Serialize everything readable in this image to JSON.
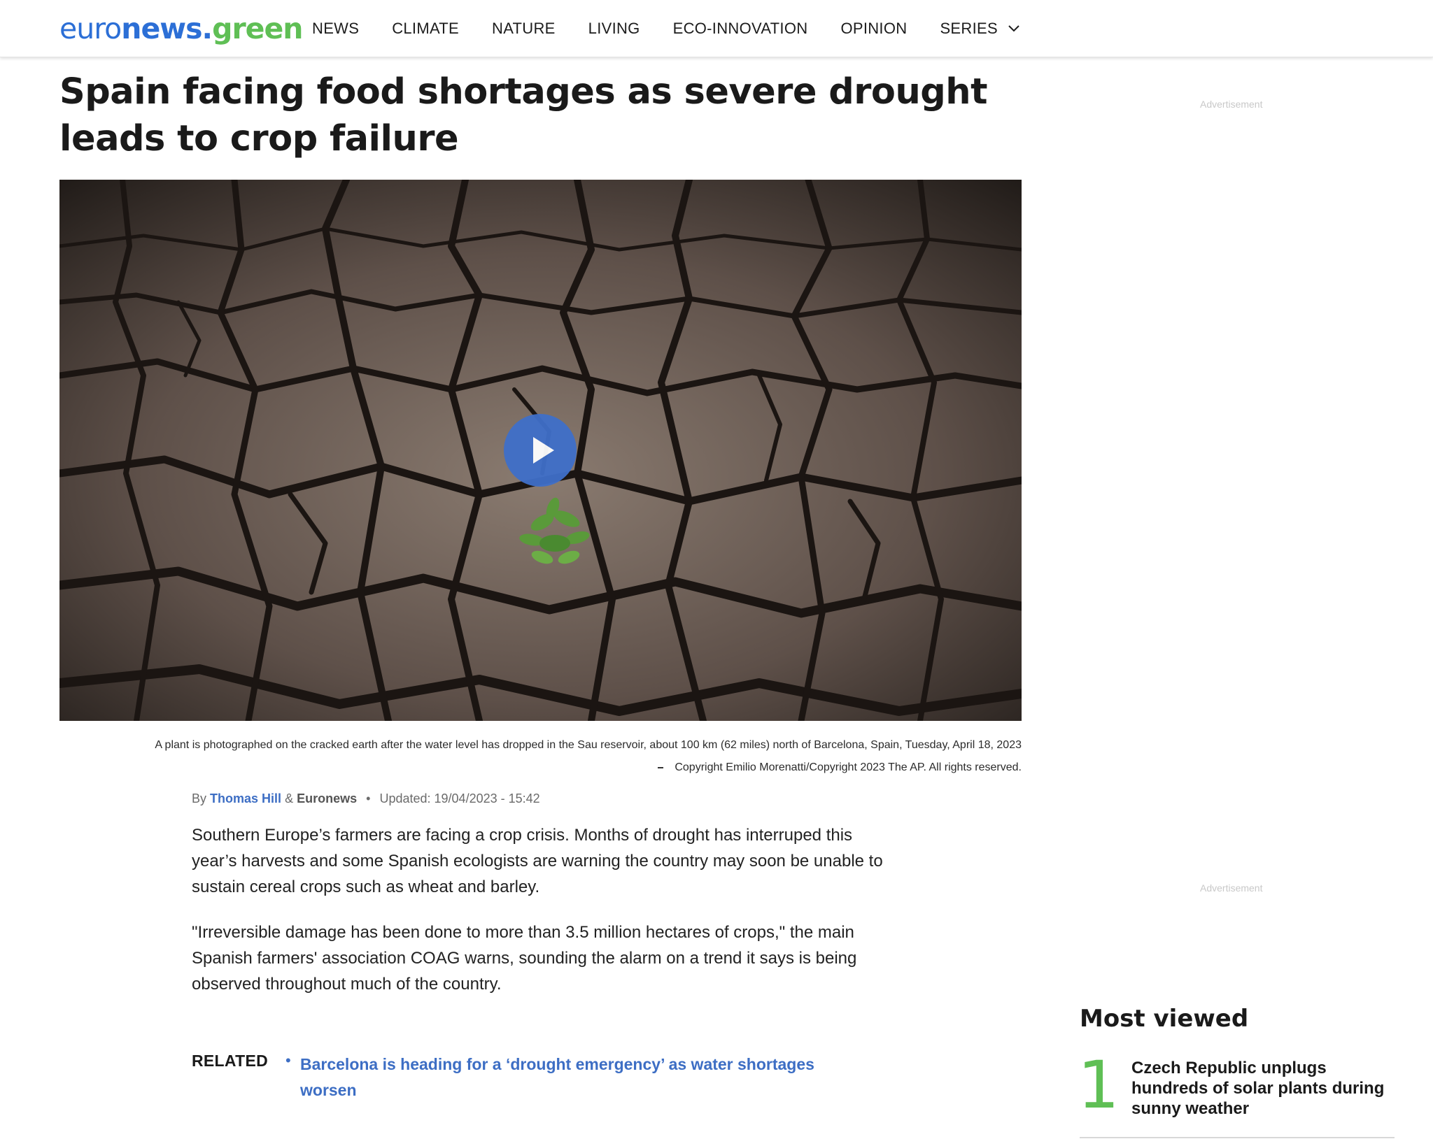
{
  "header": {
    "logo": {
      "part1": "euro",
      "part2": "news.",
      "part3": "green"
    },
    "nav": [
      {
        "label": "NEWS"
      },
      {
        "label": "CLIMATE"
      },
      {
        "label": "NATURE"
      },
      {
        "label": "LIVING"
      },
      {
        "label": "ECO-INNOVATION"
      },
      {
        "label": "OPINION"
      },
      {
        "label": "SERIES"
      }
    ]
  },
  "article": {
    "headline": "Spain facing food shortages as severe drought leads to crop failure",
    "caption": "A plant is photographed on the cracked earth after the water level has dropped in the Sau reservoir, about 100 km (62 miles) north of Barcelona, Spain, Tuesday, April 18, 2023",
    "copyright": "Copyright  Emilio Morenatti/Copyright 2023 The AP. All rights reserved.",
    "byline": {
      "by": "By",
      "author": "Thomas Hill",
      "amp": "&",
      "org": "Euronews",
      "updated": "Updated: 19/04/2023 - 15:42"
    },
    "paragraphs": [
      "Southern Europe’s farmers are facing a crop crisis. Months of drought has interruped this year’s harvests and some Spanish ecologists are warning the country may soon be unable to sustain cereal crops such as wheat and barley.",
      "\"Irreversible damage has been done to more than 3.5 million hectares of crops,\" the main Spanish farmers' association COAG warns, sounding the alarm on a trend it says is being observed throughout much of the country."
    ],
    "related": {
      "label": "RELATED",
      "bullet": "•",
      "link": "Barcelona is heading for a ‘drought emergency’ as water shortages worsen"
    }
  },
  "sidebar": {
    "ad_label": "Advertisement",
    "most_viewed": {
      "title": "Most viewed",
      "items": [
        {
          "rank": "1",
          "title": "Czech Republic unplugs hundreds of solar plants during sunny weather"
        }
      ]
    }
  },
  "colors": {
    "brand_blue": "#2c6fd6",
    "brand_green": "#5fbf55",
    "link": "#3d6ec4",
    "play_button": "#3f6fc9"
  },
  "icons": {
    "series_dropdown": "chevron-down-icon",
    "video": "play-icon"
  }
}
